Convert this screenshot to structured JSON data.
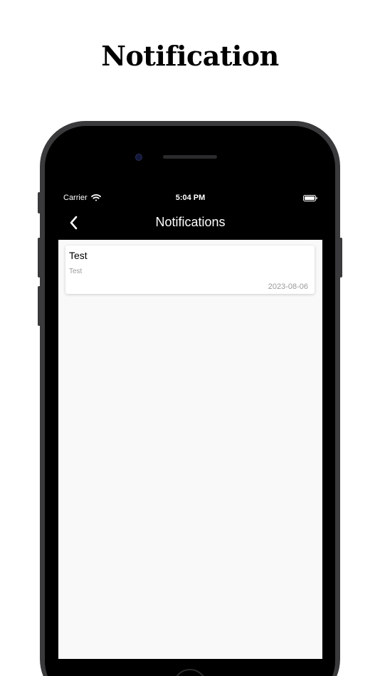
{
  "promo": {
    "title": "Notification"
  },
  "status_bar": {
    "carrier": "Carrier",
    "time": "5:04 PM",
    "wifi_icon": "wifi-icon",
    "battery_icon": "battery-icon"
  },
  "nav": {
    "title": "Notifications",
    "back_icon": "chevron-left-icon"
  },
  "notifications": [
    {
      "title": "Test",
      "body": "Test",
      "date": "2023-08-06"
    }
  ],
  "colors": {
    "nav_background": "#000000",
    "screen_background": "#f9f9f9",
    "card_background": "#ffffff",
    "muted_text": "#9a9a9a"
  }
}
